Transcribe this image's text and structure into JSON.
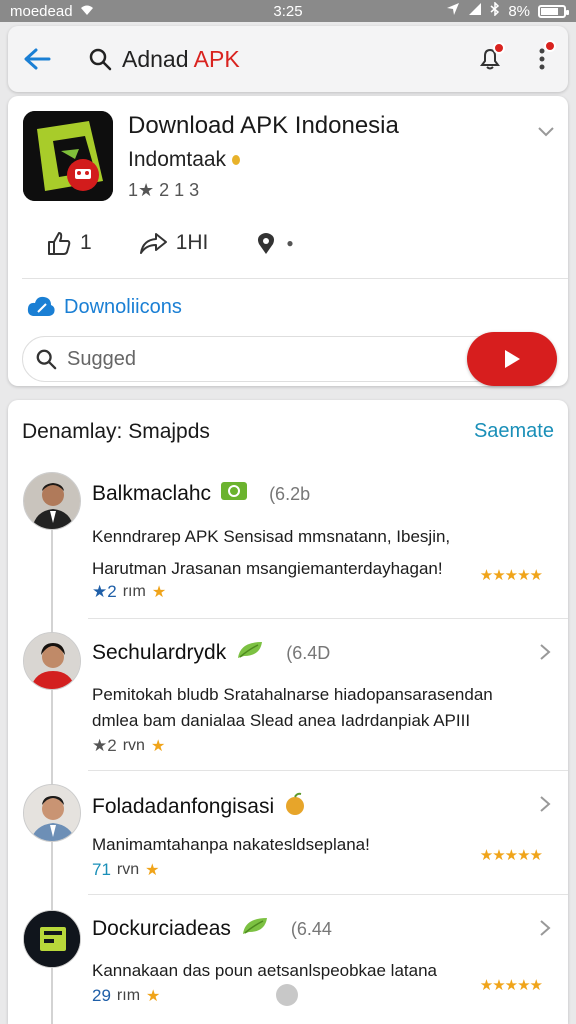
{
  "status_bar": {
    "carrier": "moedead",
    "time": "3:25",
    "battery": "8%"
  },
  "search": {
    "query_prefix": "Adnad ",
    "query_highlight": "APK"
  },
  "app": {
    "title": "Download APK Indonesia",
    "developer": "Indomtaak",
    "rating": "1★ 2 1 3",
    "likes": "1",
    "shares": "1НI",
    "downloads_link": "Downoliicons",
    "suggest_placeholder": "Sugged"
  },
  "list": {
    "header": "Denamlay: Smajpds",
    "see_more": "Saemate",
    "items": [
      {
        "title": "Balkmaclahc",
        "version": "(6.2b",
        "desc_line1": "Kenndrarep APK Sensisad mmsnatann, Ibesjin,",
        "desc_line2": "Harutman Jrasanan msangiemanterdayhagan!",
        "count": "2",
        "unit": "rım"
      },
      {
        "title": "Sechulardrydk",
        "version": "(6.4D",
        "desc_line1": "Pemitokah bludb Sratahalnarse hiadopansarasendan",
        "desc_line2": "dmlea bam danialaa Slead anea Iadrdanpiak APIII",
        "count": "2",
        "unit": "rvn"
      },
      {
        "title": "Foladadanfongisasi",
        "version": "",
        "desc_line1": "Manimamtahanpa nakatesldseplana!",
        "desc_line2": "",
        "count": "71",
        "unit": "rvn"
      },
      {
        "title": "Dockurciadeas",
        "version": "(6.44",
        "desc_line1": "Kannakaan das poun aetsanlspeobkae latana",
        "desc_line2": "",
        "count": "29",
        "unit": "rım"
      }
    ]
  },
  "colors": {
    "accent_blue": "#1a7fd4",
    "brand_red": "#d71e1e",
    "star": "#f0a41a",
    "see_more": "#1a8fb8"
  }
}
